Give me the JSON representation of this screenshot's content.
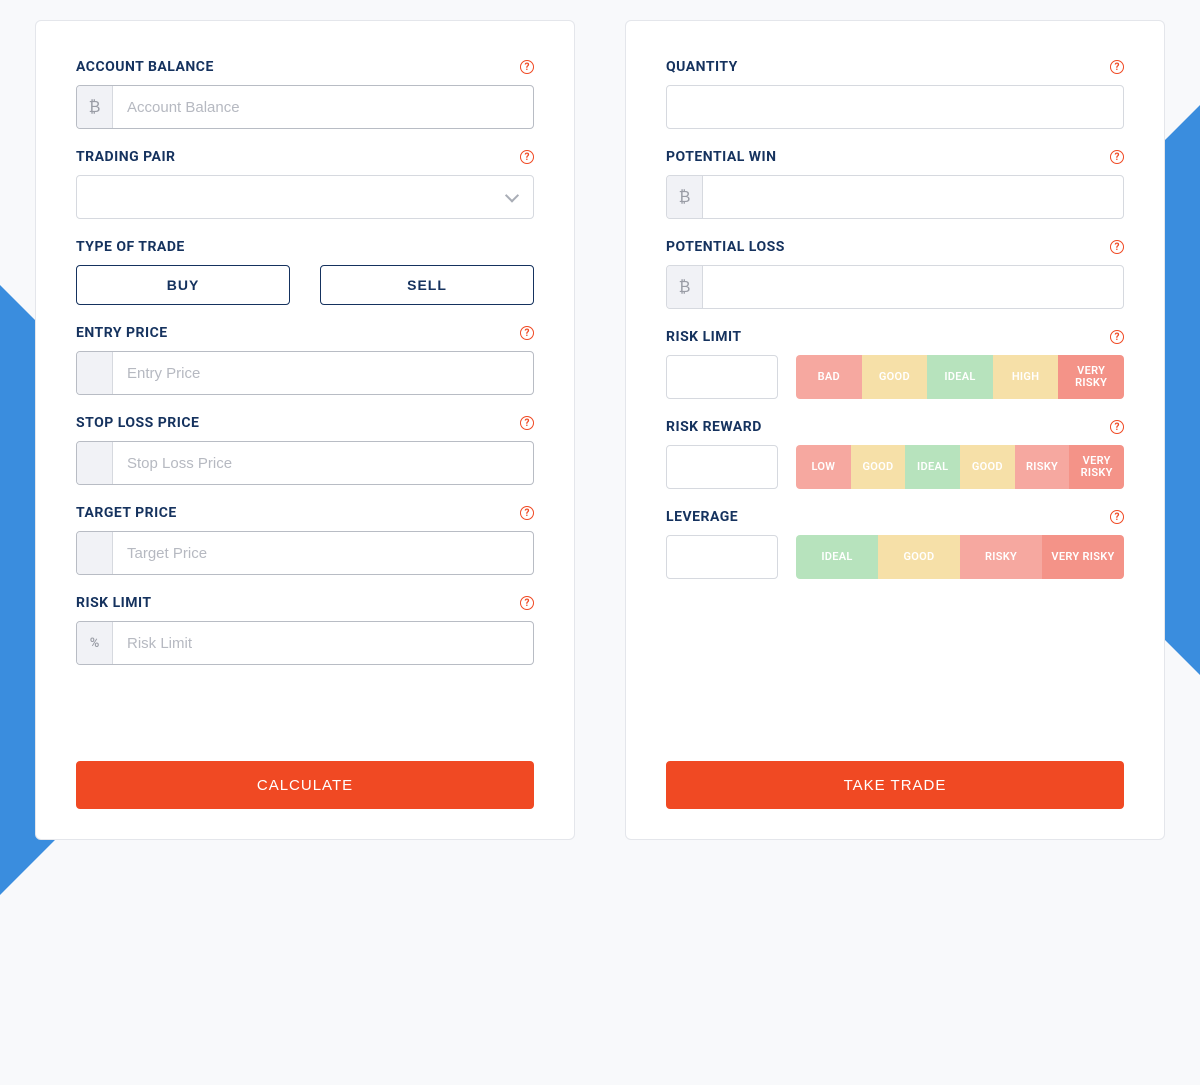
{
  "palette": {
    "red": "#f6a8a0",
    "yellow": "#f6e0a8",
    "green": "#b7e3bd",
    "dkred": "#f49388"
  },
  "left": {
    "account_balance": {
      "label": "ACCOUNT BALANCE",
      "placeholder": "Account Balance",
      "addon": "₿"
    },
    "trading_pair": {
      "label": "TRADING PAIR"
    },
    "type_of_trade": {
      "label": "TYPE OF TRADE",
      "buy": "BUY",
      "sell": "SELL"
    },
    "entry_price": {
      "label": "ENTRY PRICE",
      "placeholder": "Entry Price"
    },
    "stop_loss": {
      "label": "STOP LOSS PRICE",
      "placeholder": "Stop Loss Price"
    },
    "target_price": {
      "label": "TARGET PRICE",
      "placeholder": "Target Price"
    },
    "risk_limit": {
      "label": "RISK LIMIT",
      "placeholder": "Risk Limit",
      "addon": "%"
    },
    "calculate": "CALCULATE"
  },
  "right": {
    "quantity": {
      "label": "QUANTITY"
    },
    "potential_win": {
      "label": "POTENTIAL WIN",
      "addon": "₿"
    },
    "potential_loss": {
      "label": "POTENTIAL LOSS",
      "addon": "₿"
    },
    "risk_limit": {
      "label": "RISK LIMIT",
      "scale": [
        {
          "text": "BAD",
          "color": "red"
        },
        {
          "text": "GOOD",
          "color": "yellow"
        },
        {
          "text": "IDEAL",
          "color": "green"
        },
        {
          "text": "HIGH",
          "color": "yellow"
        },
        {
          "text": "VERY RISKY",
          "color": "dkred"
        }
      ]
    },
    "risk_reward": {
      "label": "RISK REWARD",
      "scale": [
        {
          "text": "LOW",
          "color": "red"
        },
        {
          "text": "GOOD",
          "color": "yellow"
        },
        {
          "text": "IDEAL",
          "color": "green"
        },
        {
          "text": "GOOD",
          "color": "yellow"
        },
        {
          "text": "RISKY",
          "color": "red"
        },
        {
          "text": "VERY RISKY",
          "color": "dkred"
        }
      ]
    },
    "leverage": {
      "label": "LEVERAGE",
      "scale": [
        {
          "text": "IDEAL",
          "color": "green"
        },
        {
          "text": "GOOD",
          "color": "yellow"
        },
        {
          "text": "RISKY",
          "color": "red"
        },
        {
          "text": "VERY RISKY",
          "color": "dkred"
        }
      ]
    },
    "take_trade": "TAKE TRADE"
  }
}
